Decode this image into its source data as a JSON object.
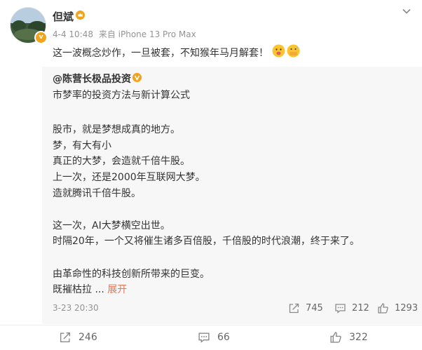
{
  "post": {
    "author": "但斌",
    "date": "4-4 10:48",
    "source": "来自 iPhone 13 Pro Max",
    "text": "这一波概念炒作，一旦被套，不知猴年马月解套！",
    "emojis": [
      "tongue-face-emoji",
      "sweat-hands-emoji"
    ]
  },
  "repost": {
    "author": "@陈营长极品投资",
    "lines": [
      "市梦率的投资方法与新计算公式",
      "股市，就是梦想成真的地方。",
      "梦，有大有小",
      "真正的大梦，会造就千倍牛股。",
      "上一次，还是2000年互联网大梦。",
      "造就腾讯千倍牛股。",
      "这一次，AI大梦横空出世。",
      "时隔20年，一个又将催生诸多百倍股，千倍股的时代浪潮，终于来了。",
      "由革命性的科技创新所带来的巨变。",
      "既摧枯拉"
    ],
    "ellipsis": " ... ",
    "expand_label": "展开",
    "date": "3-23 20:30",
    "reposts": "745",
    "comments": "212",
    "likes": "1293"
  },
  "footer": {
    "reposts": "246",
    "comments": "66",
    "likes": "322"
  },
  "colors": {
    "accent": "#eb7350",
    "badge": "#f2a31a",
    "meta": "#939393",
    "repost_bg": "#f7f7f7"
  }
}
